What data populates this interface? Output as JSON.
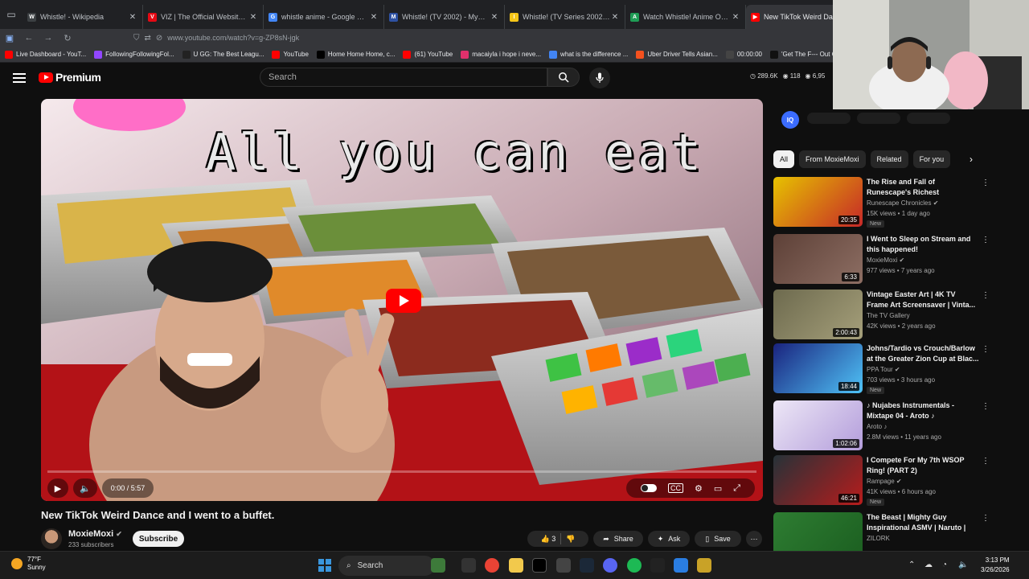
{
  "browser": {
    "tabs": [
      {
        "title": "Whistle! - Wikipedia",
        "icon": "W",
        "color": "#3c4043"
      },
      {
        "title": "VIZ | The Official Website for W",
        "icon": "V",
        "color": "#e50914"
      },
      {
        "title": "whistle anime - Google Search",
        "icon": "G",
        "color": "#4285f4"
      },
      {
        "title": "Whistle! (TV 2002) - MyAnimeL",
        "icon": "M",
        "color": "#2e51a2"
      },
      {
        "title": "Whistle! (TV Series 2002–2003)",
        "icon": "I",
        "color": "#f5c518"
      },
      {
        "title": "Watch Whistle! Anime Online | A",
        "icon": "A",
        "color": "#1f9d55"
      },
      {
        "title": "New TikTok Weird Dance",
        "icon": "▶",
        "color": "#ff0000"
      }
    ],
    "url": "www.youtube.com/watch?v=g-ZP8sN-jgk",
    "bookmarks": [
      {
        "label": "Live Dashboard - YouT...",
        "color": "#ff0000"
      },
      {
        "label": "FollowingFollowingFol...",
        "color": "#9146ff"
      },
      {
        "label": "U GG: The Best Leagu...",
        "color": "#222222"
      },
      {
        "label": "YouTube",
        "color": "#ff0000"
      },
      {
        "label": "Home Home Home, c...",
        "color": "#000000"
      },
      {
        "label": "(61) YouTube",
        "color": "#ff0000"
      },
      {
        "label": "macaiyla i hope i neve...",
        "color": "#e1306c"
      },
      {
        "label": "what is the difference ...",
        "color": "#4285f4"
      },
      {
        "label": "Uber Driver Tells Asian...",
        "color": "#f4511e"
      },
      {
        "label": "00:00:00",
        "color": "#444444"
      },
      {
        "label": "'Get The F--- Out Of M",
        "color": "#111111"
      }
    ]
  },
  "youtube": {
    "logo_text": "Premium",
    "search_placeholder": "Search",
    "stats": [
      "289.6K",
      "118",
      "6,95"
    ],
    "video": {
      "overlay_text": "All you can eat",
      "time": "0:00 / 5:57",
      "progress": 0,
      "title": "New TikTok Weird Dance and I went to a buffet.",
      "channel": "MoxieMoxi",
      "subscribers": "233 subscribers",
      "subscribe_label": "Subscribe",
      "likes": "3",
      "share_label": "Share",
      "ask_label": "Ask",
      "save_label": "Save"
    },
    "chips": [
      "All",
      "From MoxieMoxi",
      "Related",
      "For you"
    ],
    "extension_badge": "IQ",
    "recommendations": [
      {
        "title": "The Rise and Fall of Runescape's Richest Merchant...",
        "channel": "Runescape Chronicles",
        "verified": true,
        "meta": "15K views • 1 day ago",
        "badge": "New",
        "duration": "20:35",
        "thumb": [
          "#e6c200",
          "#c62828"
        ]
      },
      {
        "title": "I Went to Sleep on Stream and this happened!",
        "channel": "MoxieMoxi",
        "verified": true,
        "meta": "977 views • 7 years ago",
        "badge": "",
        "duration": "6:33",
        "thumb": [
          "#5d4037",
          "#8d6e63"
        ]
      },
      {
        "title": "Vintage Easter Art | 4K TV Frame Art Screensaver | Vinta...",
        "channel": "The TV Gallery",
        "verified": false,
        "meta": "42K views • 2 years ago",
        "badge": "",
        "duration": "2:00:43",
        "thumb": [
          "#6d6a4e",
          "#a59f7a"
        ]
      },
      {
        "title": "Johns/Tardio vs Crouch/Barlow at the Greater Zion Cup at Blac...",
        "channel": "PPA Tour",
        "verified": true,
        "meta": "703 views • 3 hours ago",
        "badge": "New",
        "duration": "18:44",
        "thumb": [
          "#1a237e",
          "#4fc3f7"
        ]
      },
      {
        "title": "♪ Nujabes Instrumentals - Mixtape 04 - Aroto ♪",
        "channel": "Aroto ♪",
        "verified": false,
        "meta": "2.8M views • 11 years ago",
        "badge": "",
        "duration": "1:02:06",
        "thumb": [
          "#ede7f6",
          "#b39ddb"
        ]
      },
      {
        "title": "I Compete For My 7th WSOP Ring! (PART 2)",
        "channel": "Rampage",
        "verified": true,
        "meta": "41K views • 6 hours ago",
        "badge": "New",
        "duration": "46:21",
        "thumb": [
          "#263238",
          "#b71c1c"
        ]
      },
      {
        "title": "The Beast | Mighty Guy Inspirational ASMV | Naruto |",
        "channel": "ZILORK",
        "verified": false,
        "meta": "",
        "badge": "",
        "duration": "",
        "thumb": [
          "#2e7d32",
          "#1b5e20"
        ]
      }
    ]
  },
  "taskbar": {
    "temperature": "77°F",
    "condition": "Sunny",
    "search_label": "Search",
    "time": "3:13 PM",
    "date": "3/26/2026"
  }
}
